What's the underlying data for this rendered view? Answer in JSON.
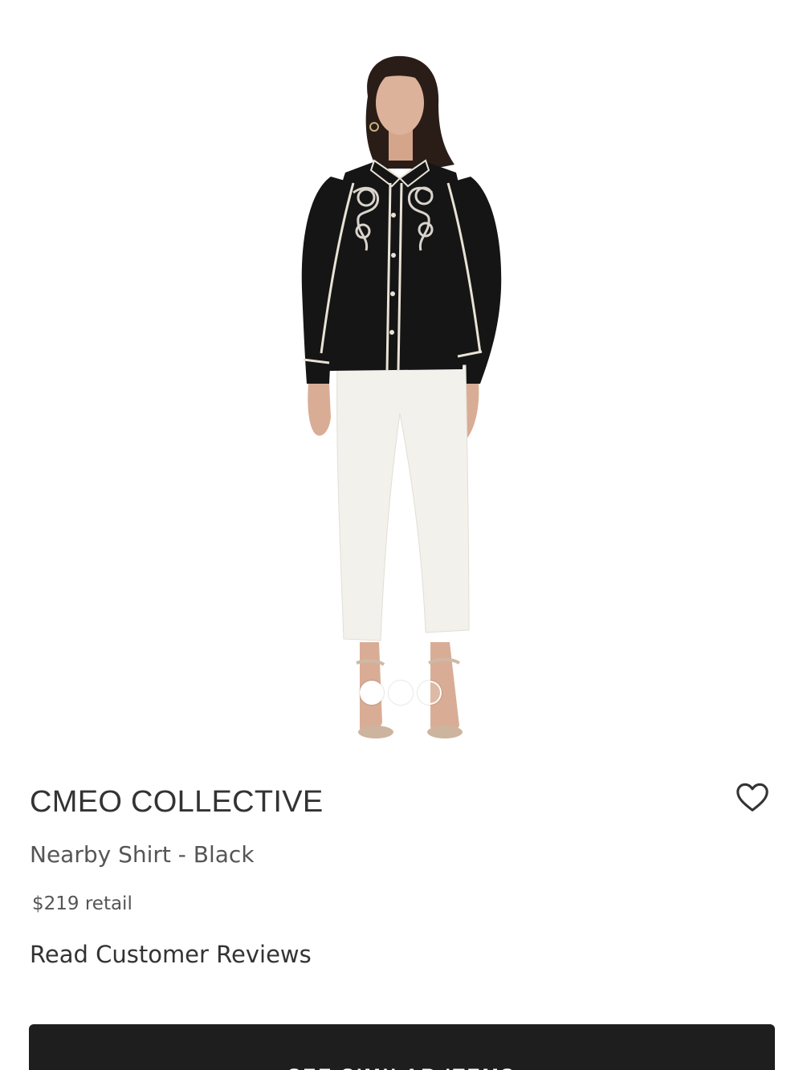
{
  "product": {
    "brand": "CMEO COLLECTIVE",
    "name": "Nearby Shirt - Black",
    "price": "$219 retail",
    "reviews_link": "Read Customer Reviews"
  },
  "gallery": {
    "image_count": 3,
    "active_index": 0,
    "image_alt": "Model wearing black embroidered shirt with white trousers"
  },
  "actions": {
    "see_similar": "SEE SIMILAR ITEMS",
    "wishlist_icon": "heart-outline-icon"
  },
  "colors": {
    "shirt": "#151515",
    "trim": "#e9e2d6",
    "pants": "#f3f1ec",
    "skin": "#d9ad95",
    "hair": "#2a1d18",
    "cta_bg": "#1e1e1e"
  }
}
